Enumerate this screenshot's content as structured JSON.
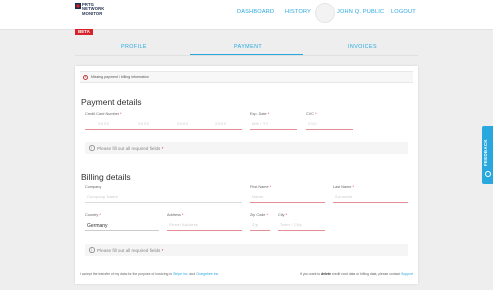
{
  "header": {
    "logo": {
      "line1": "PRTG",
      "line2": "NETWORK",
      "line3": "MONITOR",
      "badge": "BETA"
    },
    "nav": {
      "dashboard": "DASHBOARD",
      "history": "HISTORY",
      "user": "JOHN Q. PUBLIC",
      "logout": "LOGOUT"
    }
  },
  "tabs": {
    "profile": "PROFILE",
    "payment": "PAYMENT",
    "invoices": "INVOICES",
    "active": "PAYMENT"
  },
  "alert": {
    "text": "Missing payment / billing information",
    "icon": "alert-icon"
  },
  "payment": {
    "title": "Payment details",
    "card_number": {
      "label": "Credit Card Number",
      "placeholders": [
        "XXXX",
        "XXXX",
        "XXXX",
        "XXXX"
      ]
    },
    "exp_date": {
      "label": "Exp. Date",
      "placeholder": "MM / YY"
    },
    "cvc": {
      "label": "CVC",
      "placeholder": "CVC"
    },
    "hint": "Please fill out all required fields"
  },
  "billing": {
    "title": "Billing details",
    "company": {
      "label": "Company",
      "placeholder": "Company Name"
    },
    "first_name": {
      "label": "First Name",
      "placeholder": "Name"
    },
    "last_name": {
      "label": "Last Name",
      "placeholder": "Surname"
    },
    "country": {
      "label": "Country",
      "value": "Germany"
    },
    "address": {
      "label": "Address",
      "placeholder": "Street Address"
    },
    "zip": {
      "label": "Zip Code",
      "placeholder": "Zip"
    },
    "city": {
      "label": "City",
      "placeholder": "Town / City"
    },
    "hint": "Please fill out all required fields"
  },
  "footer": {
    "left_prefix": "I accept the transfer of my data for the purpose of invoicing to",
    "left_link1": "Stripe Inc.",
    "left_and": "and",
    "left_link2": "Chargebee Inc.",
    "right_prefix": "If you want to",
    "right_bold": "delete",
    "right_middle": "credit card data or billing data, please contact",
    "right_link": "Support"
  },
  "feedback": {
    "label": "FEEDBACK"
  },
  "colors": {
    "accent": "#29a8e0",
    "error_underline": "#e38f96",
    "badge": "#d8222b"
  }
}
